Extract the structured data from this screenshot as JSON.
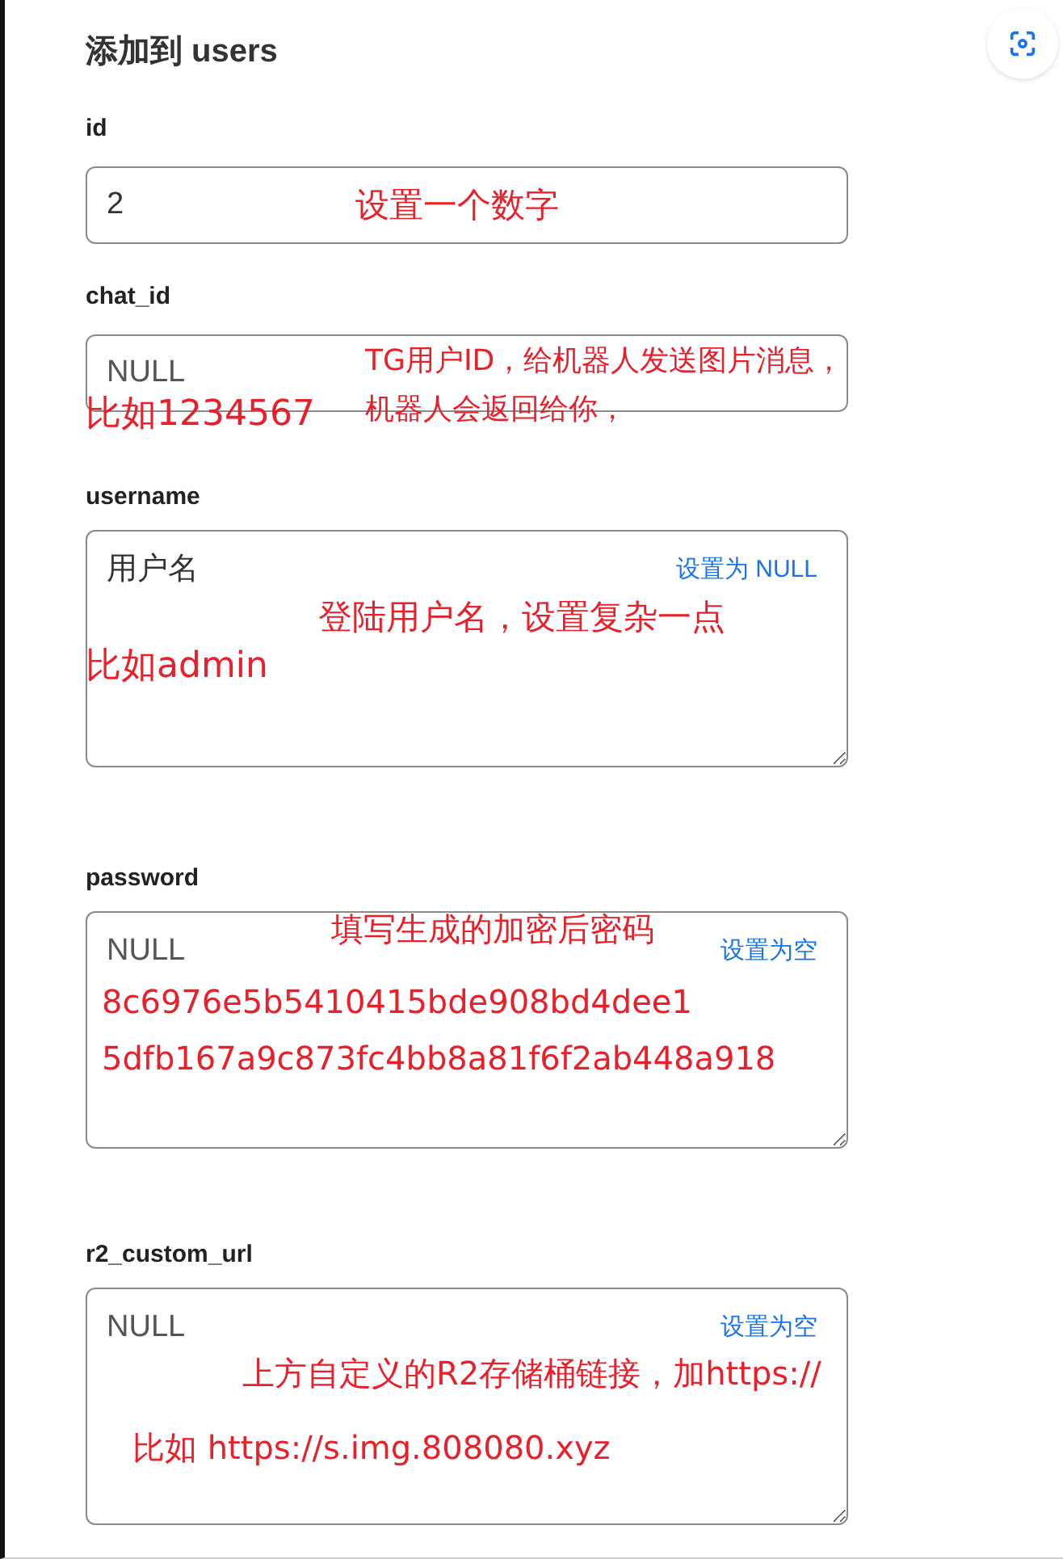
{
  "title": "添加到 users",
  "fields": [
    {
      "label": "id",
      "kind": "input",
      "value": "2"
    },
    {
      "label": "chat_id",
      "kind": "input",
      "placeholder": "NULL"
    },
    {
      "label": "username",
      "kind": "textarea",
      "value": "用户名",
      "action": "设置为 NULL"
    },
    {
      "label": "password",
      "kind": "textarea",
      "placeholder": "NULL",
      "action": "设置为空"
    },
    {
      "label": "r2_custom_url",
      "kind": "textarea",
      "placeholder": "NULL",
      "action": "设置为空"
    }
  ],
  "annotations": [
    {
      "text": "设置一个数字"
    },
    {
      "text": "TG用户ID，给机器人发送图片消息，"
    },
    {
      "text": "比如1234567"
    },
    {
      "text": "机器人会返回给你，"
    },
    {
      "text": "登陆用户名，设置复杂一点"
    },
    {
      "text": "比如admin"
    },
    {
      "text": "填写生成的加密后密码"
    },
    {
      "text": "8c6976e5b5410415bde908bd4dee1"
    },
    {
      "text": "5dfb167a9c873fc4bb8a81f6f2ab448a918"
    },
    {
      "text": "上方自定义的R2存储桶链接，加https://"
    },
    {
      "text": "比如 https://s.img.808080.xyz"
    }
  ]
}
